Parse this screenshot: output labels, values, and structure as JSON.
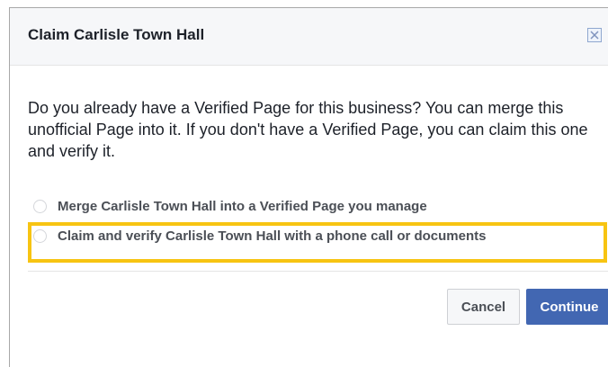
{
  "dialog": {
    "title": "Claim Carlisle Town Hall",
    "close_icon": "close-icon",
    "body": "Do you already have a Verified Page for this business? You can merge this unofficial Page into it. If you don't have a Verified Page, you can claim this one and verify it.",
    "options": [
      {
        "label": "Merge Carlisle Town Hall into a Verified Page you manage",
        "selected": false
      },
      {
        "label": "Claim and verify Carlisle Town Hall with a phone call or documents",
        "selected": false,
        "highlighted": true
      }
    ],
    "cancel_label": "Cancel",
    "continue_label": "Continue"
  },
  "colors": {
    "highlight": "#f7c412",
    "primary_button": "#4267b2",
    "header_background": "#f6f7f9"
  }
}
